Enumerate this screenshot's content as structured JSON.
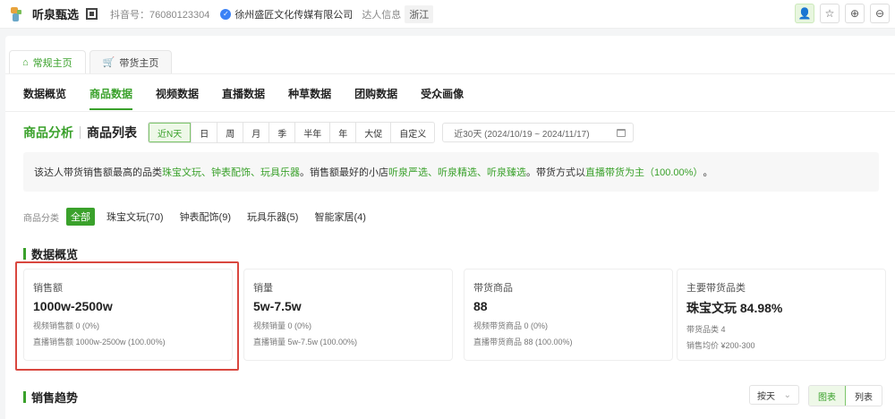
{
  "header": {
    "shop_name": "听泉甄选",
    "douyin_id": "抖音号：76080123304",
    "company": "徐州盛匠文化传媒有限公司",
    "region_label": "达人信息",
    "region": "浙江"
  },
  "main_tabs": [
    {
      "label": "常规主页"
    },
    {
      "label": "带货主页"
    }
  ],
  "sub_nav": [
    "数据概览",
    "商品数据",
    "视频数据",
    "直播数据",
    "种草数据",
    "团购数据",
    "受众画像"
  ],
  "filters": {
    "title_active": "商品分析",
    "title_other": "商品列表",
    "periods": [
      "近N天",
      "日",
      "周",
      "月",
      "季",
      "半年",
      "年",
      "大促",
      "自定义"
    ],
    "date_range": "近30天 (2024/10/19 ~ 2024/11/17)"
  },
  "summary": {
    "p1": "该达人带货销售额最高的品类",
    "cats": "珠宝文玩、钟表配饰、玩具乐器",
    "p2": "。销售额最好的小店",
    "shops": "听泉严选、听泉精选、听泉臻选",
    "p3": "。带货方式以",
    "mode": "直播带货为主（100.00%）",
    "p4": "。"
  },
  "categories": {
    "label": "商品分类",
    "items": [
      "全部",
      "珠宝文玩(70)",
      "钟表配饰(9)",
      "玩具乐器(5)",
      "智能家居(4)"
    ]
  },
  "overview": {
    "title": "数据概览",
    "cards": [
      {
        "label": "销售额",
        "value": "1000w-2500w",
        "line1": "视频销售额 0 (0%)",
        "line2": "直播销售额 1000w-2500w (100.00%)"
      },
      {
        "label": "销量",
        "value": "5w-7.5w",
        "line1": "视频销量 0 (0%)",
        "line2": "直播销量 5w-7.5w (100.00%)"
      },
      {
        "label": "带货商品",
        "value": "88",
        "line1": "视频带货商品 0 (0%)",
        "line2": "直播带货商品 88 (100.00%)"
      },
      {
        "label": "主要带货品类",
        "value": "珠宝文玩 84.98%",
        "line1": "带货品类 4",
        "line2": "销售均价 ¥200-300"
      }
    ]
  },
  "trend": {
    "title": "销售趋势",
    "select_value": "按天",
    "views": [
      "图表",
      "列表"
    ]
  }
}
